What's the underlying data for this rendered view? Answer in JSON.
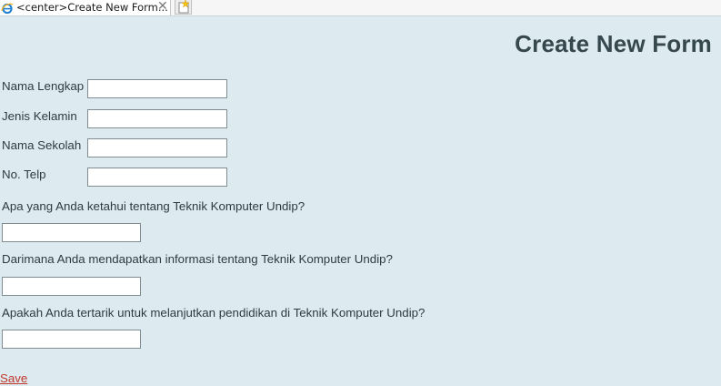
{
  "browser": {
    "tab_title": "<center>Create New Form...",
    "tab_icon": "ie-browser-icon",
    "close_icon": "close-icon",
    "new_tab_icon": "new-tab-icon"
  },
  "page": {
    "title": "Create New Form"
  },
  "form": {
    "fields": [
      {
        "label": "Nama Lengkap",
        "value": ""
      },
      {
        "label": "Jenis Kelamin",
        "value": ""
      },
      {
        "label": "Nama Sekolah",
        "value": ""
      },
      {
        "label": "No. Telp",
        "value": ""
      }
    ],
    "questions": [
      {
        "text": "Apa yang Anda ketahui tentang Teknik Komputer Undip?",
        "value": ""
      },
      {
        "text": "Darimana Anda mendapatkan informasi tentang Teknik Komputer Undip?",
        "value": ""
      },
      {
        "text": "Apakah Anda tertarik untuk melanjutkan pendidikan di Teknik Komputer Undip?",
        "value": ""
      }
    ],
    "save_label": "Save"
  },
  "colors": {
    "background": "#ddeaf0",
    "title": "#36484e",
    "link": "#c0392b"
  }
}
